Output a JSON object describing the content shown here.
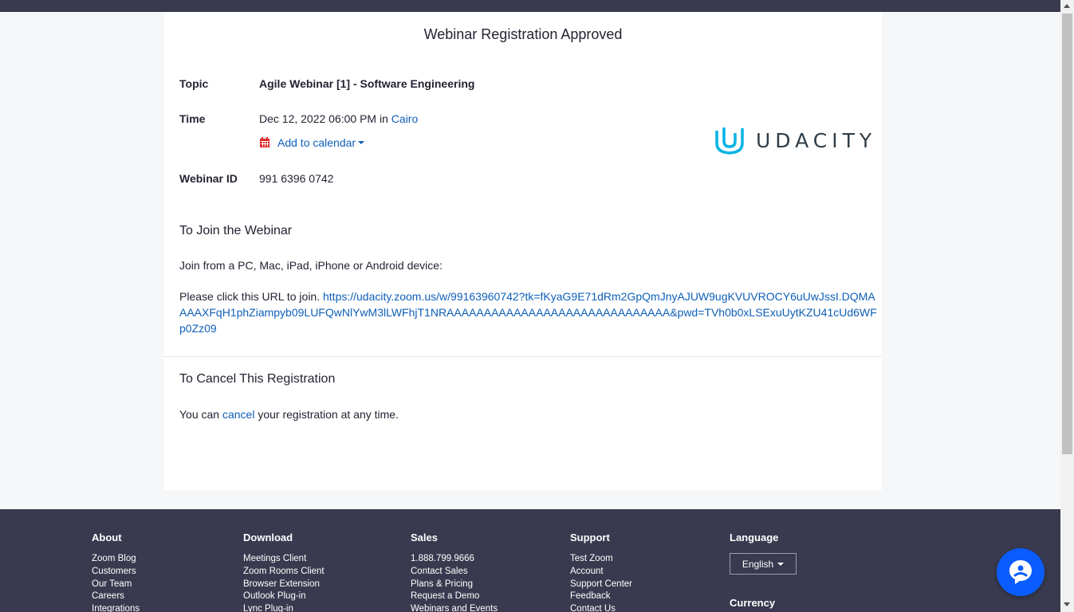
{
  "registration": {
    "title": "Webinar Registration Approved",
    "topic_label": "Topic",
    "topic_value": "Agile Webinar [1] - Software Engineering",
    "time_label": "Time",
    "time_value": "Dec 12, 2022 06:00 PM",
    "time_in": "in",
    "time_zone": "Cairo",
    "add_to_calendar": "Add to calendar",
    "webinar_id_label": "Webinar ID",
    "webinar_id_value": "991 6396 0742",
    "logo_text": "UDACITY"
  },
  "join": {
    "heading": "To Join the Webinar",
    "devices_text": "Join from a PC, Mac, iPad, iPhone or Android device:",
    "url_prefix": "Please click this URL to join.",
    "url": "https://udacity.zoom.us/w/99163960742?tk=fKyaG9E71dRm2GpQmJnyAJUW9ugKVUVROCY6uUwJssI.DQMAAAAXFqH1phZiampyb09LUFQwNlYwM3lLWFhjT1NRAAAAAAAAAAAAAAAAAAAAAAAAAAAAAA&pwd=TVh0b0xLSExuUytKZU41cUd6WFp0Zz09"
  },
  "cancel": {
    "heading": "To Cancel This Registration",
    "text_before": "You can",
    "link": "cancel",
    "text_after": "your registration at any time."
  },
  "footer": {
    "about": {
      "heading": "About",
      "links": [
        "Zoom Blog",
        "Customers",
        "Our Team",
        "Careers",
        "Integrations"
      ]
    },
    "download": {
      "heading": "Download",
      "links": [
        "Meetings Client",
        "Zoom Rooms Client",
        "Browser Extension",
        "Outlook Plug-in",
        "Lync Plug-in"
      ]
    },
    "sales": {
      "heading": "Sales",
      "links": [
        "1.888.799.9666",
        "Contact Sales",
        "Plans & Pricing",
        "Request a Demo",
        "Webinars and Events"
      ]
    },
    "support": {
      "heading": "Support",
      "links": [
        "Test Zoom",
        "Account",
        "Support Center",
        "Feedback",
        "Contact Us"
      ]
    },
    "language": {
      "heading": "Language",
      "selected": "English",
      "currency_heading": "Currency"
    }
  },
  "colors": {
    "link": "#0e5fb8",
    "footer_bg": "#393a4f",
    "chat_button": "#0b5cff",
    "calendar_icon": "#e02828",
    "logo_accent": "#02b3e4"
  },
  "icons": {
    "calendar": "calendar-icon",
    "chat": "chat-bot-icon",
    "logo": "udacity-logo-icon"
  }
}
